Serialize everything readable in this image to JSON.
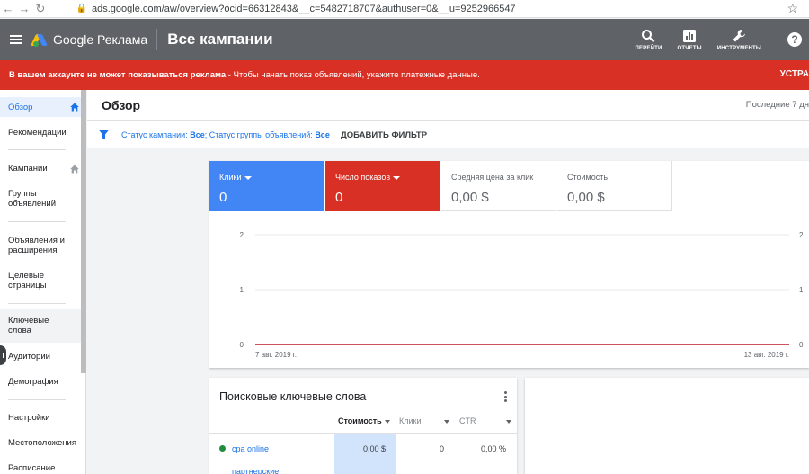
{
  "browser": {
    "url": "ads.google.com/aw/overview?ocid=66312843&__c=5482718707&authuser=0&__u=9252966547"
  },
  "header": {
    "brand": "Google Реклама",
    "page_title": "Все кампании",
    "tools": [
      {
        "label": "ПЕРЕЙТИ",
        "icon": "search-icon"
      },
      {
        "label": "ОТЧЕТЫ",
        "icon": "reports-icon"
      },
      {
        "label": "ИНСТРУМЕНТЫ",
        "icon": "wrench-icon"
      }
    ],
    "help_glyph": "?"
  },
  "alert": {
    "bold_text": "В вашем аккаунте не может показываться реклама",
    "text": " - Чтобы начать показ объявлений, укажите платежные данные.",
    "action": "УСТРА"
  },
  "sidebar": {
    "items": [
      {
        "label": "Обзор",
        "active": true,
        "home": true
      },
      {
        "label": "Рекомендации"
      },
      {
        "label": "Кампании",
        "home": true
      },
      {
        "label": "Группы объявлений"
      },
      {
        "label": "Объявления и расширения"
      },
      {
        "label": "Целевые страницы"
      },
      {
        "label": "Ключевые слова",
        "hover": true
      },
      {
        "label": "Аудитории"
      },
      {
        "label": "Демография"
      },
      {
        "label": "Настройки"
      },
      {
        "label": "Местоположения"
      },
      {
        "label": "Расписание"
      }
    ]
  },
  "main": {
    "title": "Обзор",
    "date_range": "Последние 7 дн",
    "filter": {
      "campaign_status_label": "Статус кампании:",
      "campaign_status_value": "Все",
      "group_status_label": "; Статус группы объявлений:",
      "group_status_value": "Все",
      "add_filter": "ДОБАВИТЬ ФИЛЬТР"
    }
  },
  "metrics": [
    {
      "label": "Клики",
      "value": "0",
      "selected": true,
      "color": "#4285f4"
    },
    {
      "label": "Число показов",
      "value": "0",
      "selected": true,
      "color": "#d93025"
    },
    {
      "label": "Средняя цена за клик",
      "value": "0,00 $",
      "selected": false
    },
    {
      "label": "Стоимость",
      "value": "0,00 $",
      "selected": false
    }
  ],
  "chart_data": {
    "type": "line",
    "x": [
      "7 авг. 2019 г.",
      "13 авг. 2019 г."
    ],
    "series": [
      {
        "name": "Клики",
        "values": [
          0,
          0
        ],
        "color": "#4285f4"
      },
      {
        "name": "Число показов",
        "values": [
          0,
          0
        ],
        "color": "#d93025"
      }
    ],
    "ylim": [
      0,
      2
    ],
    "yticks": [
      "0",
      "1",
      "2"
    ],
    "y2ticks": [
      "0",
      "1",
      "2"
    ],
    "grid": true
  },
  "keywords_card": {
    "title": "Поисковые ключевые слова",
    "columns": [
      "Стоимость",
      "Клики",
      "CTR"
    ],
    "rows": [
      {
        "keyword": "cpa online",
        "cost": "0,00 $",
        "clicks": "0",
        "ctr": "0,00 %"
      },
      {
        "keyword": "партнерские",
        "cost": "",
        "clicks": "",
        "ctr": ""
      }
    ]
  }
}
